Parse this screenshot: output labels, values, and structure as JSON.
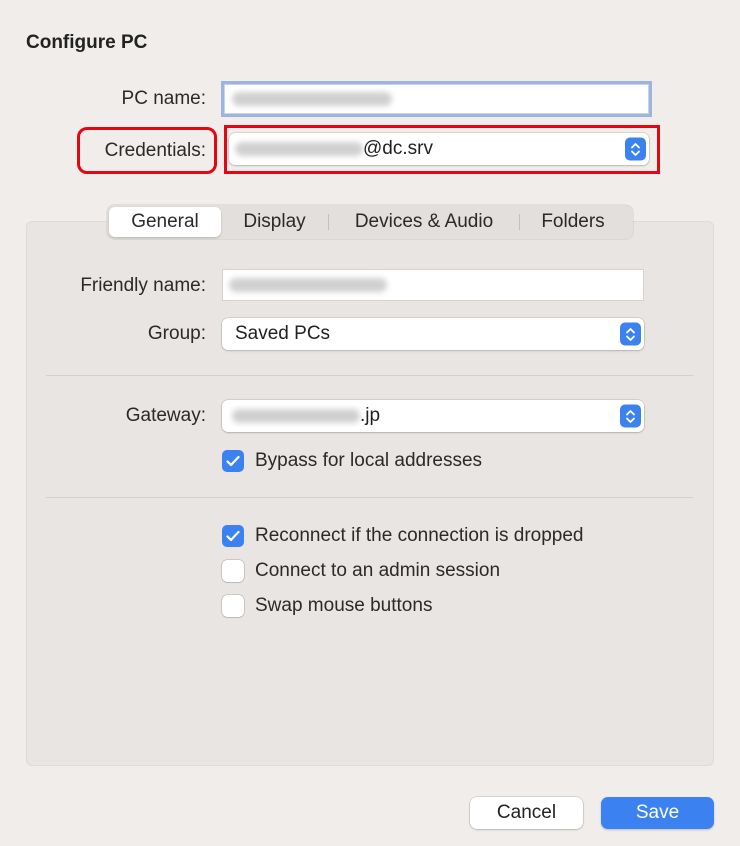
{
  "dialog": {
    "title": "Configure PC",
    "pc_name_label": "PC name:",
    "credentials_label": "Credentials:",
    "credentials_suffix": "@dc.srv"
  },
  "tabs": [
    {
      "label": "General",
      "active": true
    },
    {
      "label": "Display",
      "active": false
    },
    {
      "label": "Devices & Audio",
      "active": false
    },
    {
      "label": "Folders",
      "active": false
    }
  ],
  "general": {
    "friendly_name_label": "Friendly name:",
    "group_label": "Group:",
    "group_value": "Saved PCs",
    "gateway_label": "Gateway:",
    "gateway_suffix": ".jp",
    "bypass_label": "Bypass for local addresses",
    "bypass_checked": true,
    "options": [
      {
        "label": "Reconnect if the connection is dropped",
        "checked": true
      },
      {
        "label": "Connect to an admin session",
        "checked": false
      },
      {
        "label": "Swap mouse buttons",
        "checked": false
      }
    ]
  },
  "footer": {
    "cancel_label": "Cancel",
    "save_label": "Save"
  },
  "colors": {
    "accent": "#3b82f0",
    "highlight": "#e30613",
    "background": "#f0edea"
  }
}
